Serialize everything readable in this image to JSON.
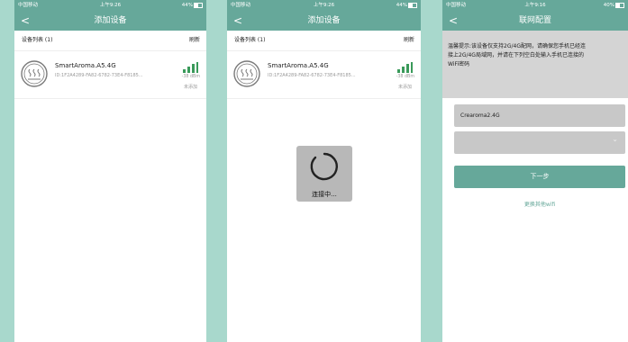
{
  "status_bar": {
    "carrier": "中国移动",
    "battery_text": "44%"
  },
  "screen1": {
    "time": "上午9:26",
    "title": "添加设备",
    "back": "<",
    "list_header": "设备列表 (1)",
    "refresh": "刷新",
    "device": {
      "name": "SmartAroma.A5.4G",
      "uuid": "ID:1F2A4289-FA82-6782-73E4-F8185...",
      "rssi": "-38 dBm",
      "status": "未添加"
    }
  },
  "screen2": {
    "time": "上午9:26",
    "title": "添加设备",
    "back": "<",
    "list_header": "设备列表 (1)",
    "refresh": "刷新",
    "device": {
      "name": "SmartAroma.A5.4G",
      "uuid": "ID:1F2A4289-FA82-6782-73E4-F8185...",
      "rssi": "-38 dBm",
      "status": "未添加"
    },
    "loading_text": "连接中..."
  },
  "screen3": {
    "time": "上午9:16",
    "title": "联网配置",
    "back": "<",
    "battery_text": "40%",
    "tip_line1": "温馨提示:该设备仅支持2G/4G配网，请确保您手机已经连",
    "tip_line2": "接上2G/4G局域网，并请在下列空白处输入手机已连接的",
    "tip_line3": "WiFi密码",
    "ssid_value": "Crearoma2.4G",
    "password_value": "",
    "next_button": "下一步",
    "other_wifi": "更换其他wifi"
  },
  "colors": {
    "header": "#66a89a",
    "background": "#a8d8cc",
    "loading_overlay": "#b8b8b8"
  }
}
